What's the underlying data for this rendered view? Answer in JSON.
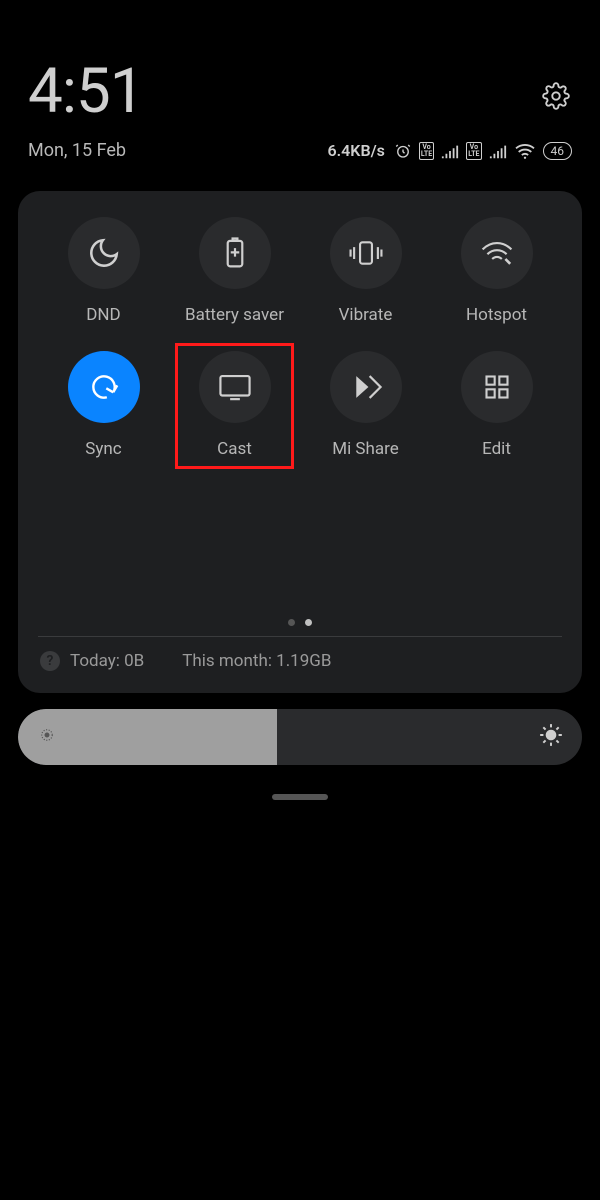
{
  "header": {
    "time": "4:51",
    "date": "Mon, 15 Feb",
    "net_speed": "6.4KB/s",
    "battery": "46"
  },
  "tiles": [
    {
      "id": "dnd",
      "label": "DND",
      "icon": "moon",
      "active": false
    },
    {
      "id": "battery",
      "label": "Battery saver",
      "icon": "battery",
      "active": false
    },
    {
      "id": "vibrate",
      "label": "Vibrate",
      "icon": "vibrate",
      "active": false
    },
    {
      "id": "hotspot",
      "label": "Hotspot",
      "icon": "hotspot",
      "active": false
    },
    {
      "id": "sync",
      "label": "Sync",
      "icon": "sync",
      "active": true
    },
    {
      "id": "cast",
      "label": "Cast",
      "icon": "cast",
      "active": false,
      "highlighted": true
    },
    {
      "id": "mishare",
      "label": "Mi Share",
      "icon": "mishare",
      "active": false
    },
    {
      "id": "edit",
      "label": "Edit",
      "icon": "grid",
      "active": false
    }
  ],
  "pager": {
    "total": 2,
    "current": 2
  },
  "usage": {
    "today_label": "Today: 0B",
    "month_label": "This month: 1.19GB"
  },
  "brightness": {
    "percent": 46
  },
  "colors": {
    "accent": "#0a84ff",
    "highlight_box": "#ff1a1a"
  }
}
